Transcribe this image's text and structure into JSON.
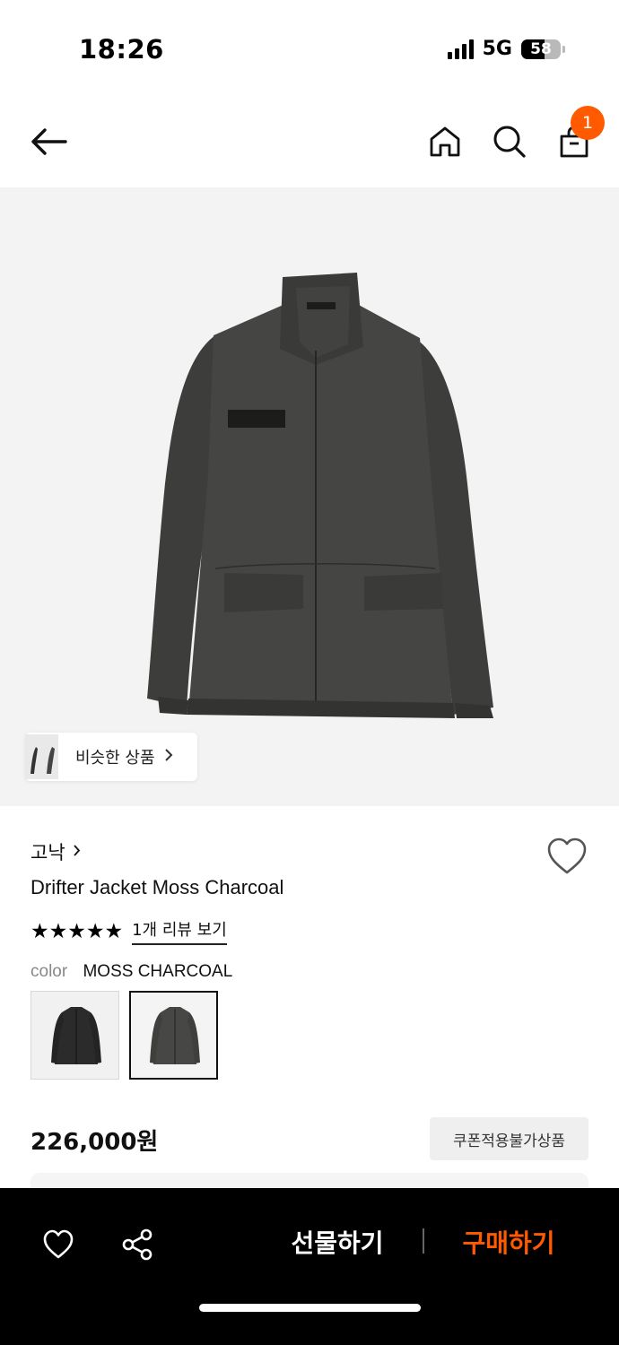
{
  "status": {
    "time": "18:26",
    "network": "5G",
    "battery": "58",
    "battery_level": 0.58
  },
  "nav": {
    "cart_badge": "1",
    "icons": [
      "back-arrow-icon",
      "home-icon",
      "search-icon",
      "shopping-bag-icon"
    ]
  },
  "gallery": {
    "similar_label": "비슷한 상품",
    "similar_chevron": "›"
  },
  "product": {
    "brand": "고낙",
    "brand_chevron": "›",
    "title": "Drifter Jacket Moss Charcoal",
    "stars": "★★★★★",
    "rating": 5,
    "review_link": "1개 리뷰 보기",
    "color_label": "color",
    "color_value": "MOSS CHARCOAL",
    "swatches": [
      "black",
      "moss-charcoal"
    ],
    "selected_swatch": 1,
    "price": "226,000원",
    "coupon_badge": "쿠폰적용불가상품"
  },
  "bottom_bar": {
    "gift_label": "선물하기",
    "buy_label": "구매하기",
    "buy_color": "#ff5a00",
    "icons": [
      "heart-icon",
      "share-icon"
    ]
  }
}
